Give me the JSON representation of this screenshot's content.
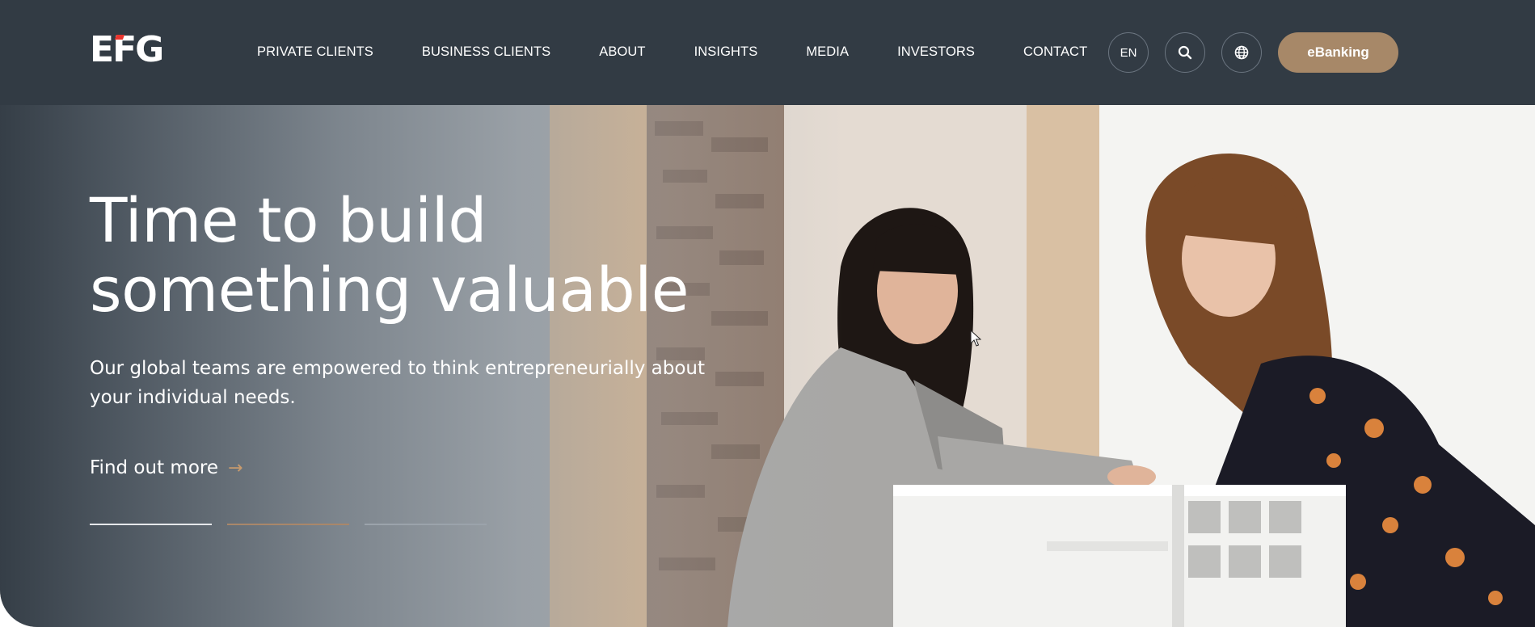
{
  "header": {
    "logo": {
      "text": "EFG",
      "accent_color": "#e8342e"
    },
    "nav": [
      {
        "label": "PRIVATE CLIENTS"
      },
      {
        "label": "BUSINESS CLIENTS"
      },
      {
        "label": "ABOUT"
      },
      {
        "label": "INSIGHTS"
      },
      {
        "label": "MEDIA"
      },
      {
        "label": "INVESTORS"
      },
      {
        "label": "CONTACT"
      }
    ],
    "language": "EN",
    "search_icon": "search-icon",
    "globe_icon": "globe-icon",
    "ebanking_label": "eBanking"
  },
  "hero": {
    "title": "Time to build something valuable",
    "text": "Our global teams are empowered to think entrepreneurially about your individual needs.",
    "cta_label": "Find out more",
    "cta_icon": "arrow-right-icon",
    "slider": {
      "count": 3,
      "active_index": 1
    }
  },
  "colors": {
    "header_bg": "#323b44",
    "accent": "#a78868",
    "cta_arrow": "#c89b6d"
  }
}
